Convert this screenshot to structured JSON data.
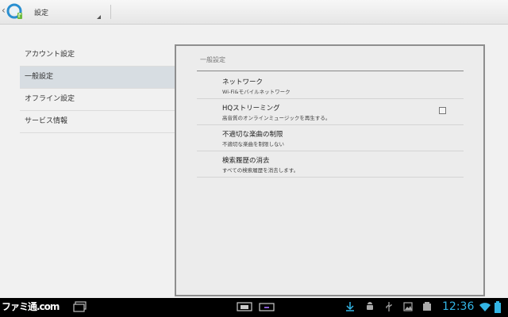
{
  "app": {
    "title": "設定",
    "icon": "music-app-icon"
  },
  "sidebar": {
    "items": [
      {
        "label": "アカウント設定",
        "selected": false
      },
      {
        "label": "一般設定",
        "selected": true
      },
      {
        "label": "オフライン設定",
        "selected": false
      },
      {
        "label": "サービス情報",
        "selected": false
      }
    ]
  },
  "main": {
    "header": "一般設定",
    "prefs": [
      {
        "title": "ネットワーク",
        "summary": "Wi-Fi&モバイルネットワーク"
      },
      {
        "title": "HQストリーミング",
        "summary": "高音質のオンラインミュージックを再生する。",
        "checked": false
      },
      {
        "title": "不適切な楽曲の制限",
        "summary": "不適切な楽曲を制限しない"
      },
      {
        "title": "検索履歴の消去",
        "summary": "すべての検索履歴を消去します。"
      }
    ]
  },
  "system_bar": {
    "watermark": "ファミ通.com",
    "time": "12:36",
    "icons": [
      "recent-apps-icon",
      "screenshot-icon",
      "keyboard-icon",
      "download-icon",
      "android-icon",
      "usb-icon",
      "image-icon",
      "media-icon",
      "wifi-icon",
      "battery-icon"
    ]
  },
  "colors": {
    "clock": "#33b5e5",
    "selected_row": "#d7dde2"
  }
}
